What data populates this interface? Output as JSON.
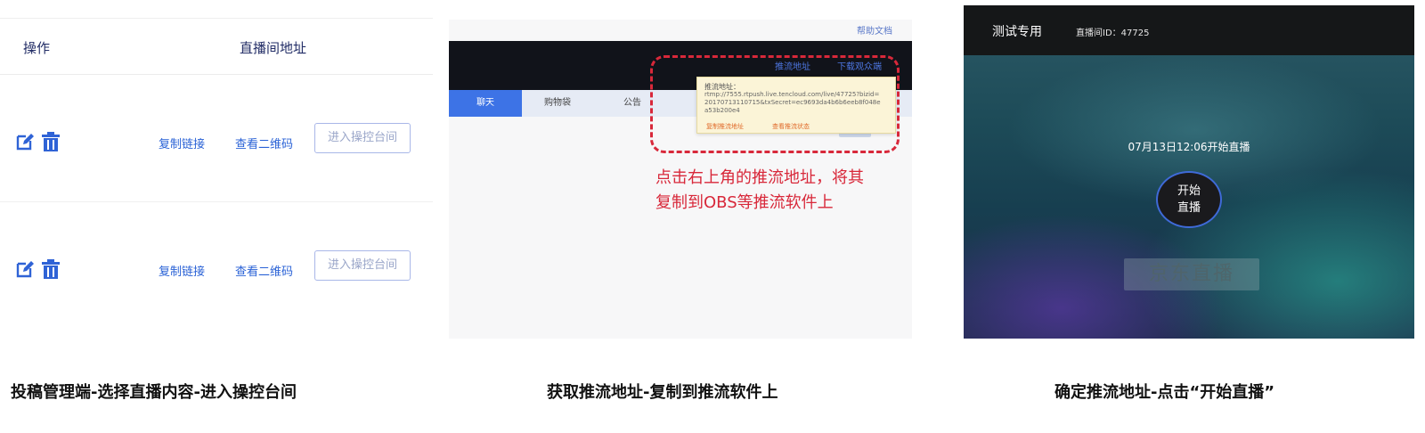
{
  "panel1": {
    "header": {
      "ops": "操作",
      "address": "直播间地址"
    },
    "rows": [
      {
        "copy_link": "复制链接",
        "view_qr": "查看二维码",
        "enter_console": "进入操控台间"
      },
      {
        "copy_link": "复制链接",
        "view_qr": "查看二维码",
        "enter_console": "进入操控台间"
      }
    ],
    "icons": {
      "edit": "edit-icon",
      "delete": "trash-icon"
    }
  },
  "panel2": {
    "help_doc": "帮助文档",
    "push_address": "推流地址",
    "download": "下载观众端",
    "tabs": [
      "聊天",
      "购物袋",
      "公告"
    ],
    "popup": {
      "title": "推流地址：",
      "url": "rtmp://7555.rtpush.live.tencloud.com/live/47725?bizid=20170713110715&txSecret=ec9693da4b6b6eeb8f048ea53b200e4",
      "action1": "复制推流地址",
      "action2": "查看推流状态"
    },
    "annotation_line1": "点击右上角的推流地址，将其",
    "annotation_line2": "复制到OBS等推流软件上",
    "colors": {
      "annotation": "#d8283a",
      "active_tab": "#3d73e6"
    }
  },
  "panel3": {
    "title": "测试专用",
    "room_id": "直播间ID：47725",
    "start_time": "07月13日12:06开始直播",
    "start_button_line1": "开始",
    "start_button_line2": "直播",
    "watermark": "京东直播"
  },
  "captions": {
    "c1": "投稿管理端-选择直播内容-进入操控台间",
    "c2": "获取推流地址-复制到推流软件上",
    "c3": "确定推流地址-点击“开始直播”"
  }
}
